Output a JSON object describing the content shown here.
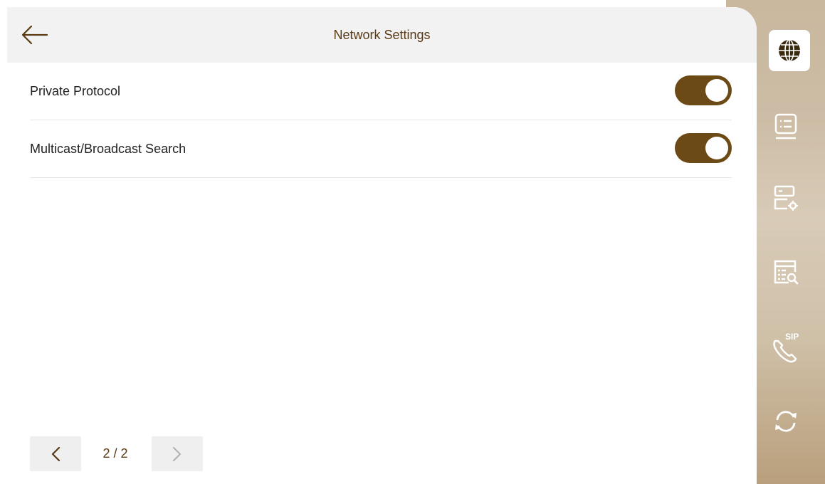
{
  "header": {
    "title": "Network Settings",
    "back_icon": "arrow-left-icon"
  },
  "settings": [
    {
      "label": "Private Protocol",
      "enabled": true
    },
    {
      "label": "Multicast/Broadcast Search",
      "enabled": true
    }
  ],
  "pagination": {
    "page_text": "2 / 2",
    "prev_icon": "chevron-left-icon",
    "next_icon": "chevron-right-icon"
  },
  "sidebar": {
    "items": [
      {
        "icon": "globe-icon",
        "active": true
      },
      {
        "icon": "device-list-icon",
        "active": false
      },
      {
        "icon": "server-settings-icon",
        "active": false
      },
      {
        "icon": "log-search-icon",
        "active": false
      },
      {
        "icon": "sip-phone-icon",
        "text": "SIP",
        "active": false
      },
      {
        "icon": "refresh-icon",
        "active": false
      }
    ]
  },
  "colors": {
    "accent": "#6b4a16",
    "title": "#5a3a12",
    "header_bg": "#f2f2f2"
  }
}
